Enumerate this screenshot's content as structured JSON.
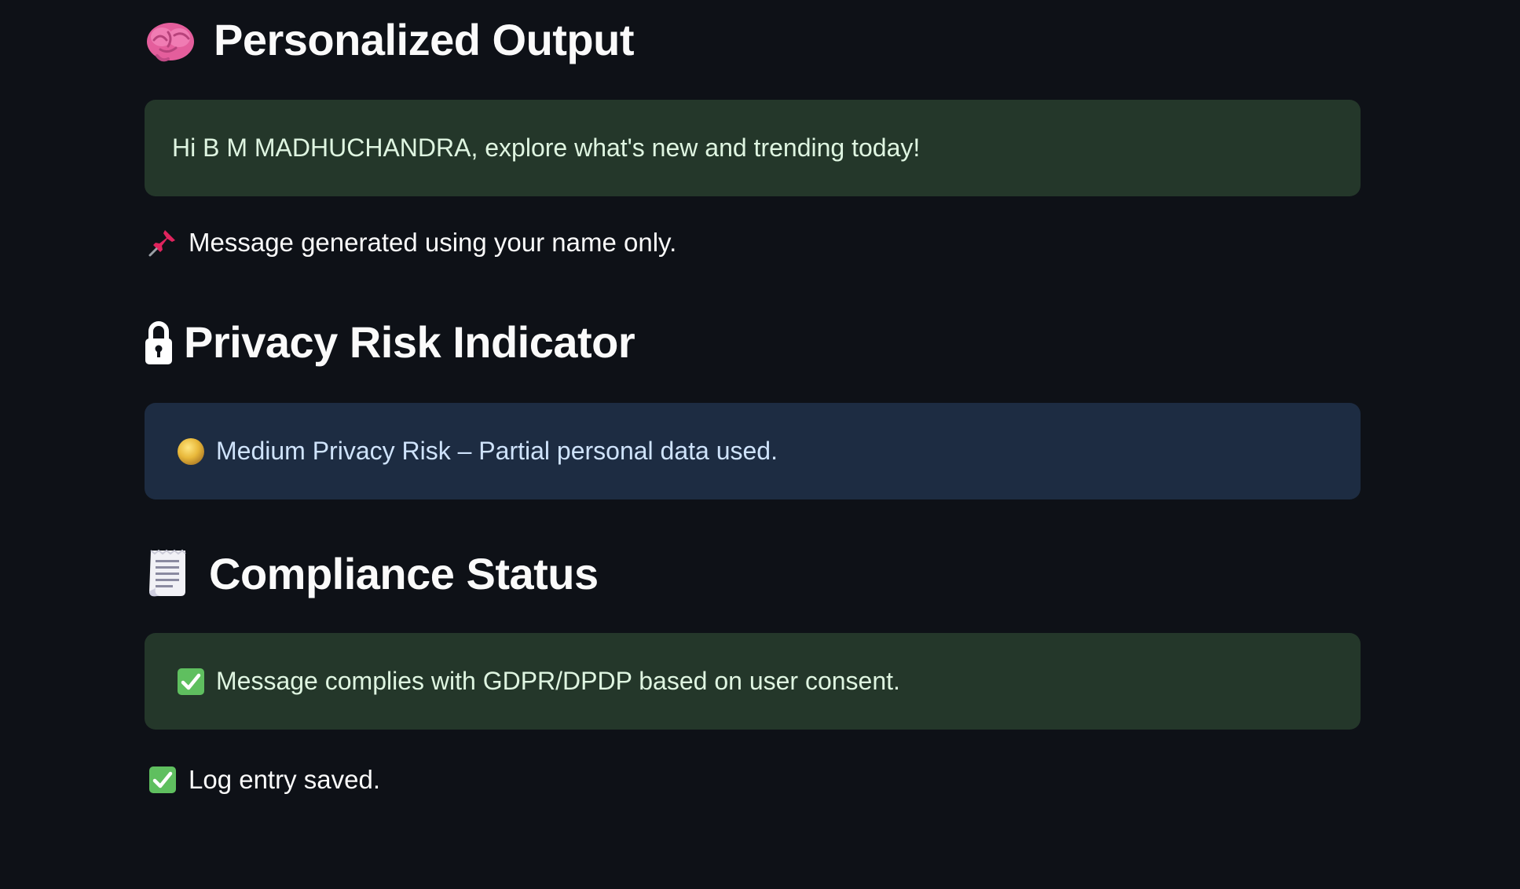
{
  "personalized_output": {
    "icon": "brain-icon",
    "title": "Personalized Output",
    "message": "Hi B M MADHUCHANDRA, explore what's new and trending today!",
    "note_icon": "pushpin-icon",
    "note": "Message generated using your name only."
  },
  "privacy_risk": {
    "icon": "lock-icon",
    "title": "Privacy Risk Indicator",
    "status_icon": "yellow-circle-icon",
    "message": "Medium Privacy Risk – Partial personal data used."
  },
  "compliance": {
    "icon": "receipt-icon",
    "title": "Compliance Status",
    "status_icon": "check-mark-icon",
    "message": "Message complies with GDPR/DPDP based on user consent.",
    "log_icon": "check-mark-icon",
    "log_message": "Log entry saved."
  },
  "colors": {
    "background": "#0e1117",
    "success_bg": "#24372a",
    "info_bg": "#1d2c42",
    "text": "#fafafa"
  }
}
